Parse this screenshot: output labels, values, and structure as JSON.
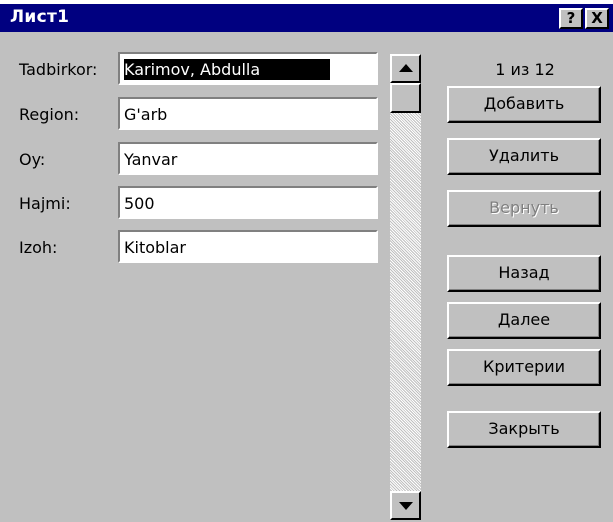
{
  "window": {
    "title": "Лист1",
    "help_glyph": "?",
    "close_glyph": "X"
  },
  "fields": [
    {
      "label": "Tadbirkor:",
      "value": "Karimov, Abdulla",
      "selected": true
    },
    {
      "label": "Region:",
      "value": "G'arb"
    },
    {
      "label": "Oy:",
      "value": "Yanvar"
    },
    {
      "label": "Hajmi:",
      "value": "500"
    },
    {
      "label": "Izoh:",
      "value": "Kitoblar"
    }
  ],
  "record_counter": "1 из 12",
  "buttons": {
    "add": "Добавить",
    "delete": "Удалить",
    "restore": "Вернуть",
    "prev": "Назад",
    "next": "Далее",
    "criteria": "Критерии",
    "close": "Закрыть"
  },
  "colors": {
    "titlebar": "#000080",
    "face": "#c0c0c0",
    "field_bg": "#ffffff",
    "selection": "#000000"
  }
}
